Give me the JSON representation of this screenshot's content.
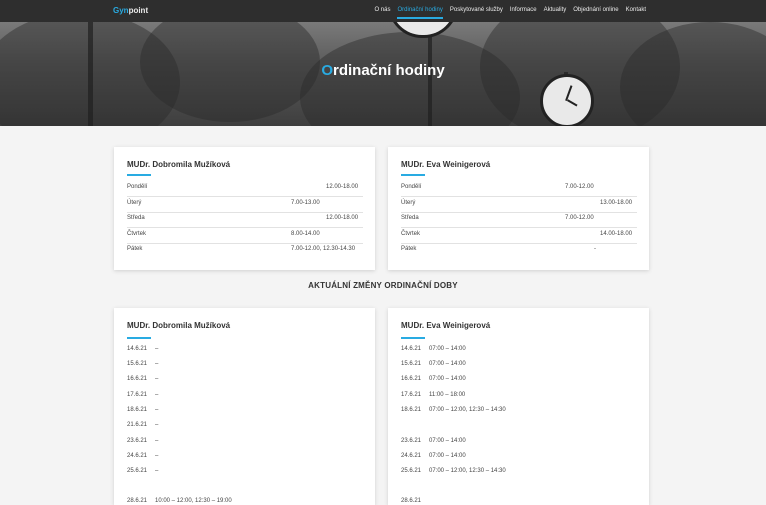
{
  "nav": {
    "logo_main": "Gyn",
    "logo_rest": "point",
    "items": [
      {
        "label": "O nás",
        "active": false
      },
      {
        "label": "Ordinační hodiny",
        "active": true
      },
      {
        "label": "Poskytované služby",
        "active": false
      },
      {
        "label": "Informace",
        "active": false
      },
      {
        "label": "Aktuality",
        "active": false
      },
      {
        "label": "Objednání online",
        "active": false
      },
      {
        "label": "Kontakt",
        "active": false
      }
    ]
  },
  "hero": {
    "title_first": "O",
    "title_rest": "rdinační hodiny"
  },
  "hours": [
    {
      "doctor": "MUDr. Dobromila Mužíková",
      "rows": [
        {
          "day": "Pondělí",
          "time": "12.00-18.00"
        },
        {
          "day": "Úterý",
          "time": "7.00-13.00"
        },
        {
          "day": "Středa",
          "time": "12.00-18.00"
        },
        {
          "day": "Čtvrtek",
          "time": "8.00-14.00"
        },
        {
          "day": "Pátek",
          "time": "7.00-12.00, 12.30-14.30"
        }
      ]
    },
    {
      "doctor": "MUDr. Eva Weinigerová",
      "rows": [
        {
          "day": "Pondělí",
          "time": "7.00-12.00"
        },
        {
          "day": "Úterý",
          "time": "13.00-18.00"
        },
        {
          "day": "Středa",
          "time": "7.00-12.00"
        },
        {
          "day": "Čtvrtek",
          "time": "14.00-18.00"
        },
        {
          "day": "Pátek",
          "time": "-"
        }
      ]
    }
  ],
  "changes_heading": "AKTUÁLNÍ ZMĚNY ORDINAČNÍ DOBY",
  "changes": [
    {
      "doctor": "MUDr. Dobromila Mužíková",
      "rows": [
        {
          "date": "14.6.21",
          "time": "–"
        },
        {
          "date": "15.6.21",
          "time": "–"
        },
        {
          "date": "16.6.21",
          "time": "–"
        },
        {
          "date": "17.6.21",
          "time": "–"
        },
        {
          "date": "18.6.21",
          "time": "–"
        },
        {
          "date": "21.6.21",
          "time": "–"
        },
        {
          "date": "23.6.21",
          "time": "–"
        },
        {
          "date": "24.6.21",
          "time": "–"
        },
        {
          "date": "25.6.21",
          "time": "–"
        },
        {
          "date": "28.6.21",
          "time": "10:00 – 12:00, 12:30 – 19:00"
        }
      ]
    },
    {
      "doctor": "MUDr. Eva Weinigerová",
      "rows": [
        {
          "date": "14.6.21",
          "time": "07:00 – 14:00"
        },
        {
          "date": "15.6.21",
          "time": "07:00 – 14:00"
        },
        {
          "date": "16.6.21",
          "time": "07:00 – 14:00"
        },
        {
          "date": "17.6.21",
          "time": "11:00 – 18:00"
        },
        {
          "date": "18.6.21",
          "time": "07:00 – 12:00, 12:30 – 14:30"
        },
        {
          "date": "23.6.21",
          "time": "07:00 – 14:00"
        },
        {
          "date": "24.6.21",
          "time": "07:00 – 14:00"
        },
        {
          "date": "25.6.21",
          "time": "07:00 – 12:00, 12:30 – 14:30"
        },
        {
          "date": "28.6.21",
          "time": ""
        }
      ]
    }
  ]
}
